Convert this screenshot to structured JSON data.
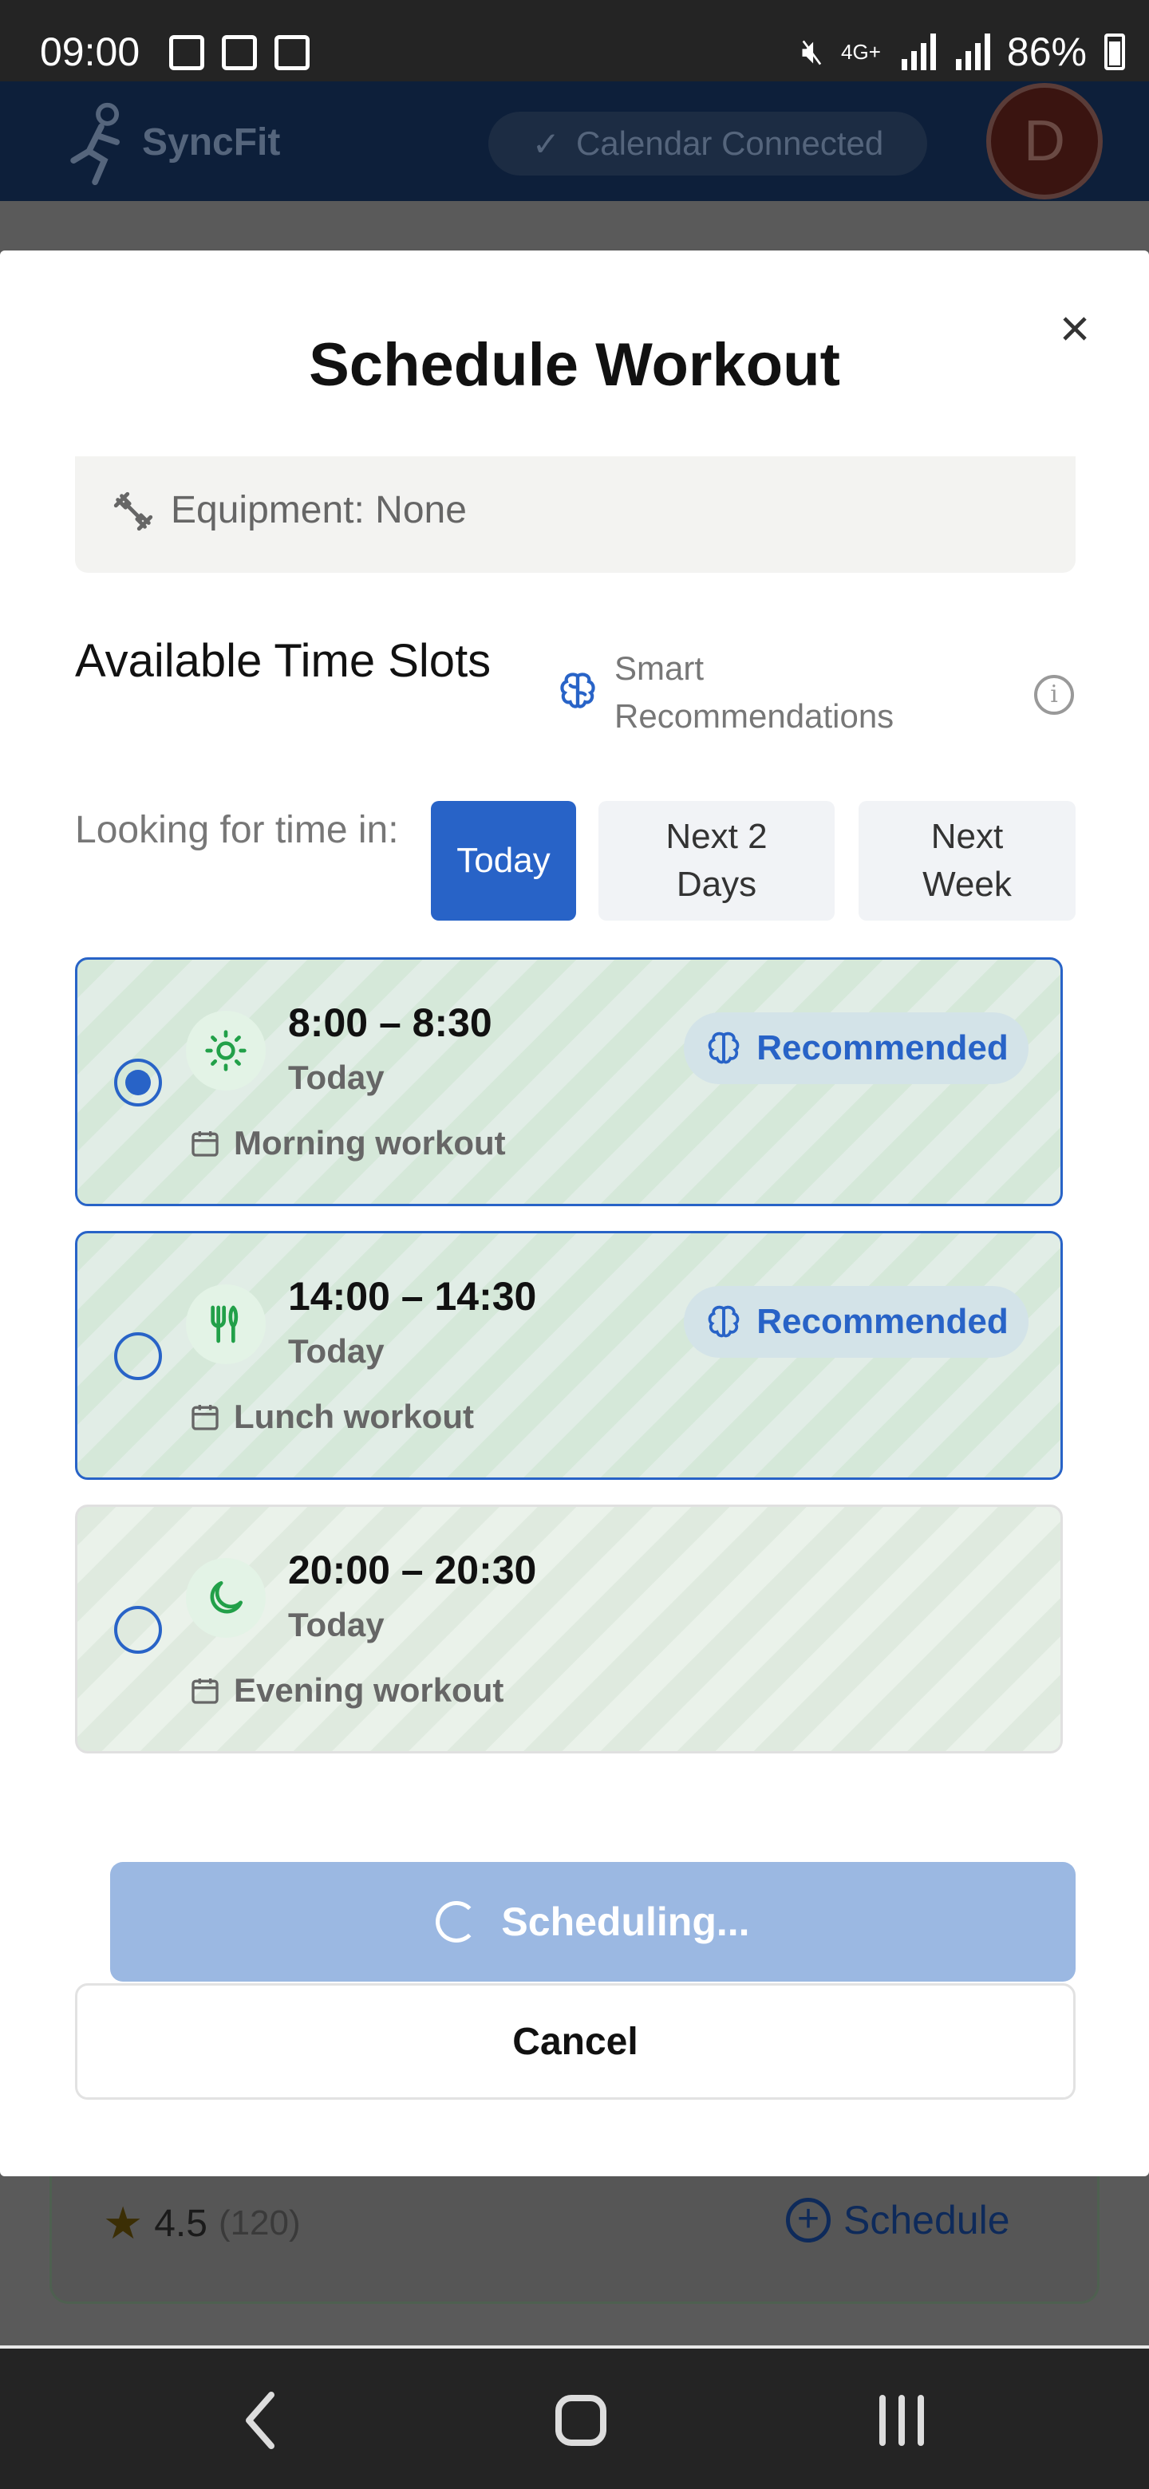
{
  "status_bar": {
    "time": "09:00",
    "network": "4G+",
    "battery": "86%"
  },
  "app_header": {
    "brand": "SyncFit",
    "calendar_status": "Calendar Connected",
    "avatar_initial": "D"
  },
  "modal": {
    "title": "Schedule Workout",
    "close_icon": "×",
    "equipment": "Equipment: None",
    "slots_title": "Available Time Slots",
    "smart_recommendations": "Smart Recommendations",
    "info_icon": "i",
    "looking_for": "Looking for time in:",
    "ranges": [
      {
        "label": "Today",
        "active": true
      },
      {
        "label": "Next 2 Days",
        "active": false
      },
      {
        "label": "Next Week",
        "active": false
      }
    ],
    "slots": [
      {
        "time": "8:00 – 8:30",
        "day": "Today",
        "label": "Morning workout",
        "icon": "sun-icon",
        "badge": "Recommended",
        "selected": true
      },
      {
        "time": "14:00 – 14:30",
        "day": "Today",
        "label": "Lunch workout",
        "icon": "utensils-icon",
        "badge": "Recommended",
        "selected": false
      },
      {
        "time": "20:00 – 20:30",
        "day": "Today",
        "label": "Evening workout",
        "icon": "moon-icon",
        "badge": "",
        "selected": false
      }
    ],
    "scheduling_label": "Scheduling...",
    "cancel_label": "Cancel"
  },
  "background_card": {
    "rating": "4.5",
    "rating_count": "(120)",
    "schedule_label": "Schedule",
    "plus_icon": "+"
  },
  "colors": {
    "primary": "#2863c7",
    "header_dimmed": "#0d1f3a",
    "slot_green": "#dfeadf",
    "icon_green": "#22a049"
  }
}
